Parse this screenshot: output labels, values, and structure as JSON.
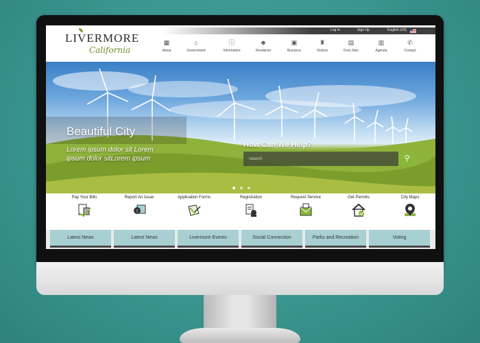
{
  "header": {
    "logo_main": "LIVERMORE",
    "logo_sub": "California",
    "top_links": [
      "Log In",
      "Sign Up",
      "English (US)"
    ],
    "nav": [
      {
        "label": "About",
        "icon": "buildings-icon",
        "glyph": "▦"
      },
      {
        "label": "Government",
        "icon": "capitol-icon",
        "glyph": "⌂"
      },
      {
        "label": "Information",
        "icon": "info-icon",
        "glyph": "ⓘ"
      },
      {
        "label": "Residents",
        "icon": "people-icon",
        "glyph": "☻"
      },
      {
        "label": "Business",
        "icon": "briefcase-icon",
        "glyph": "▣"
      },
      {
        "label": "Visitors",
        "icon": "statue-icon",
        "glyph": "♜"
      },
      {
        "label": "Find Jobs",
        "icon": "jobs-icon",
        "glyph": "▤"
      },
      {
        "label": "Agenda",
        "icon": "calendar-icon",
        "glyph": "▥"
      },
      {
        "label": "Contact",
        "icon": "phone-icon",
        "glyph": "✆"
      }
    ]
  },
  "hero": {
    "title": "Beautiful City",
    "text": "Lorem ipsum dolor sit Lorem ipsum dolor sitLorem ipsum",
    "help_title": "How Can We Help?",
    "search_placeholder": "Search"
  },
  "quick_links": [
    {
      "label": "Pay Your Bills",
      "icon": "bill-payment-icon"
    },
    {
      "label": "Report An Issue",
      "icon": "report-issue-icon"
    },
    {
      "label": "Application Forms",
      "icon": "forms-icon"
    },
    {
      "label": "Registration",
      "icon": "registration-icon"
    },
    {
      "label": "Request Service",
      "icon": "request-service-icon"
    },
    {
      "label": "Get Permits",
      "icon": "permit-house-icon"
    },
    {
      "label": "City Maps",
      "icon": "map-pin-icon"
    }
  ],
  "tabs": [
    "Latest News",
    "Latest News",
    "Livermore Events",
    "Social Connection",
    "Parks and Recreation",
    "Voting"
  ],
  "colors": {
    "accent_green": "#8ab83a",
    "tab_bg": "#a8d0d3",
    "backdrop": "#3a9690"
  }
}
